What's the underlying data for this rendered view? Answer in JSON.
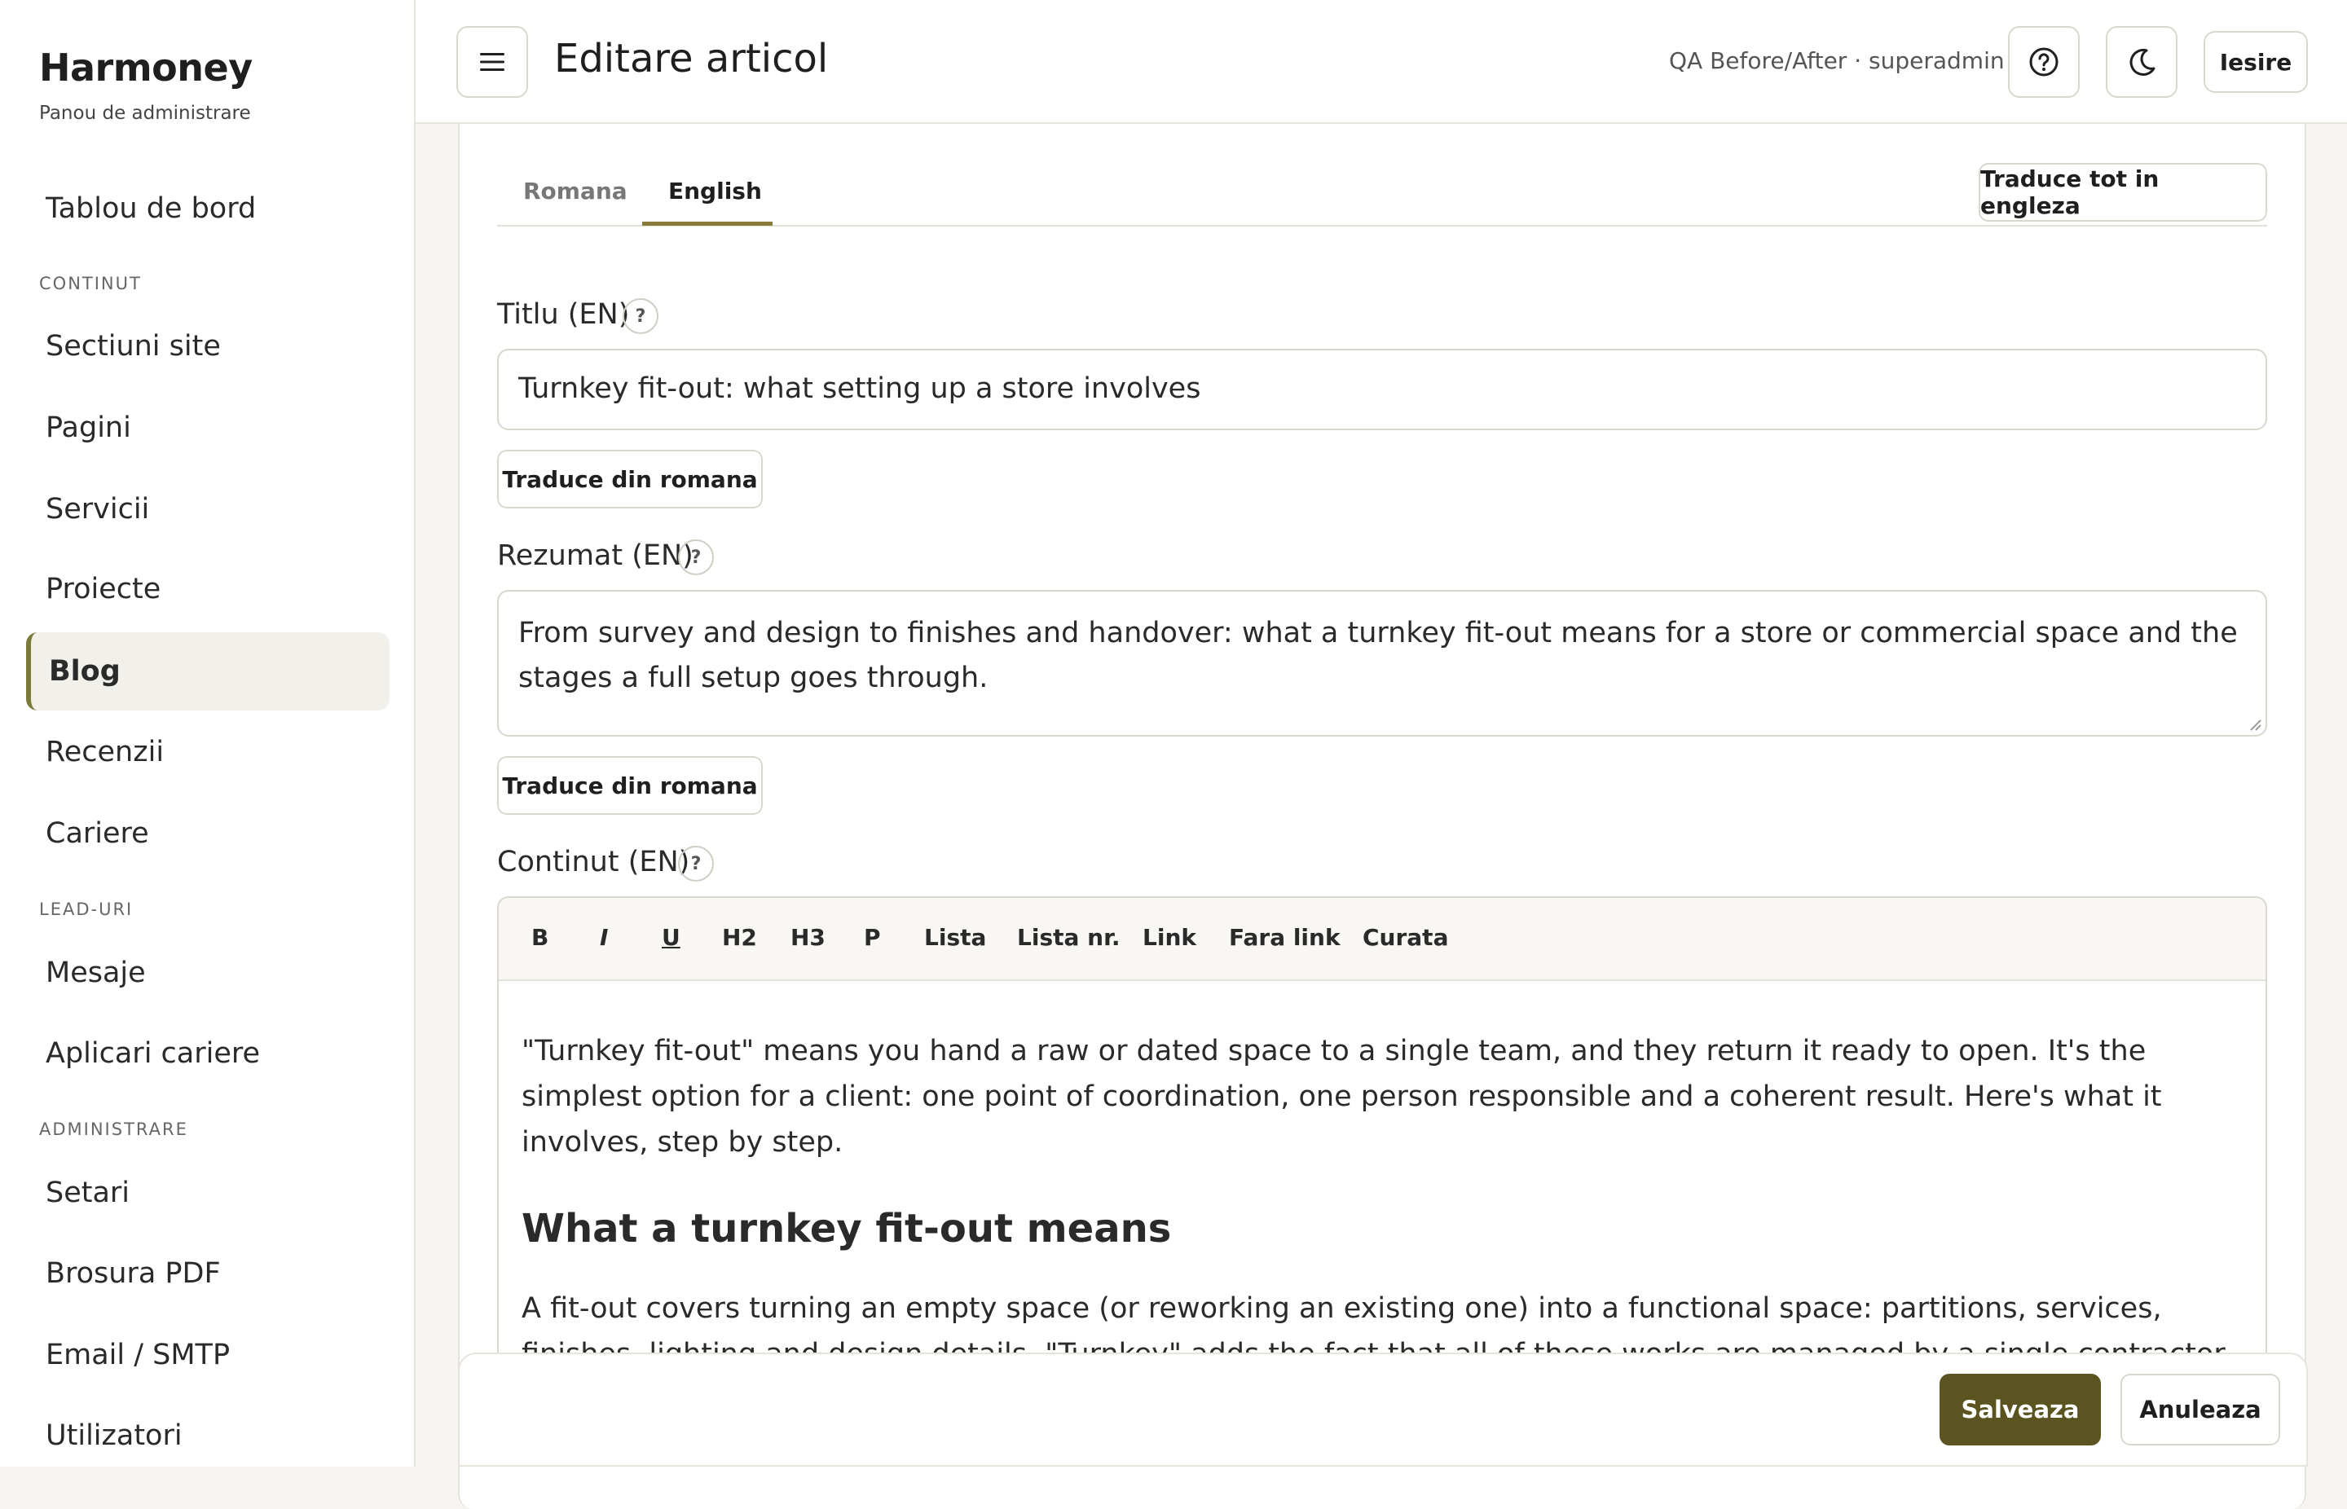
{
  "brand": {
    "title": "Harmoney",
    "subtitle": "Panou de administrare"
  },
  "sidebar": {
    "top_item": "Tablou de bord",
    "sections": [
      {
        "title": "CONTINUT",
        "items": [
          "Sectiuni site",
          "Pagini",
          "Servicii",
          "Proiecte",
          "Blog",
          "Recenzii",
          "Cariere"
        ]
      },
      {
        "title": "LEAD-URI",
        "items": [
          "Mesaje",
          "Aplicari cariere"
        ]
      },
      {
        "title": "ADMINISTRARE",
        "items": [
          "Setari",
          "Brosura PDF",
          "Email / SMTP",
          "Utilizatori"
        ]
      }
    ],
    "active_item": "Blog"
  },
  "header": {
    "title": "Editare articol",
    "meta": "QA Before/After · superadmin",
    "exit_label": "Iesire",
    "icons": [
      "menu-icon",
      "help-circle-icon",
      "moon-icon"
    ]
  },
  "tabs": {
    "items": [
      "Romana",
      "English"
    ],
    "active": "English",
    "translate_all_label": "Traduce tot in engleza"
  },
  "fields": {
    "title": {
      "label": "Titlu (EN)",
      "value": "Turnkey fit-out: what setting up a store involves",
      "translate_label": "Traduce din romana"
    },
    "summary": {
      "label": "Rezumat (EN)",
      "value": "From survey and design to finishes and handover: what a turnkey fit-out means for a store or commercial space and the stages a full setup goes through.",
      "translate_label": "Traduce din romana"
    },
    "content": {
      "label": "Continut (EN)",
      "toolbar": [
        "B",
        "I",
        "U",
        "H2",
        "H3",
        "P",
        "Lista",
        "Lista nr.",
        "Link",
        "Fara link",
        "Curata"
      ],
      "paragraph1": "\"Turnkey fit-out\" means you hand a raw or dated space to a single team, and they return it ready to open. It's the simplest option for a client: one point of coordination, one person responsible and a coherent result. Here's what it involves, step by step.",
      "heading1": "What a turnkey fit-out means",
      "paragraph2": "A fit-out covers turning an empty space (or reworking an existing one) into a functional space: partitions, services, finishes, lighting and design details. \"Turnkey\" adds the fact that all of these works are managed by a single contractor who coordinates the trades"
    },
    "help_glyph": "?"
  },
  "footer": {
    "save_label": "Salveaza",
    "cancel_label": "Anuleaza"
  },
  "colors": {
    "accent": "#8a7a3c",
    "save_bg": "#5c5420",
    "active_nav_bg": "#f1f0ea"
  }
}
